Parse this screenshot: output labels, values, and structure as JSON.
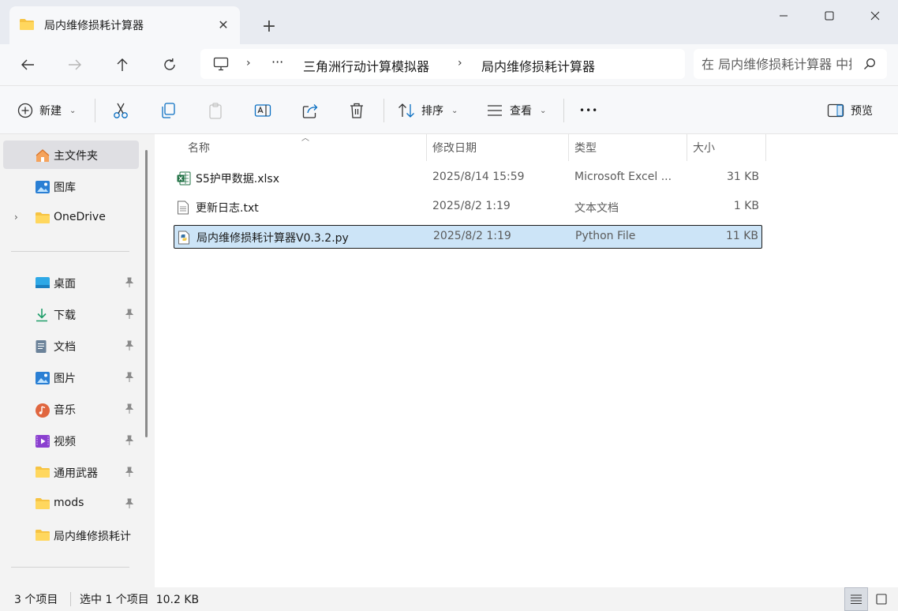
{
  "tab": {
    "title": "局内维修损耗计算器",
    "close": "✕",
    "new_tab": "+"
  },
  "window": {
    "minimize": "—",
    "close": "✕"
  },
  "address": {
    "ellipsis": "···",
    "separator": "›",
    "crumbs": [
      "三角洲行动计算模拟器",
      "局内维修损耗计算器"
    ],
    "search_placeholder": "在 局内维修损耗计算器 中搜索"
  },
  "toolbar": {
    "new_label": "新建",
    "sort_label": "排序",
    "view_label": "查看",
    "more_label": "•••",
    "preview_label": "预览"
  },
  "sidebar": {
    "top_items": [
      {
        "label": "主文件夹",
        "icon": "home-icon"
      },
      {
        "label": "图库",
        "icon": "gallery-icon"
      },
      {
        "label": "OneDrive",
        "icon": "folder-icon"
      }
    ],
    "quick_access": [
      {
        "label": "桌面",
        "icon": "desktop-icon"
      },
      {
        "label": "下载",
        "icon": "download-icon"
      },
      {
        "label": "文档",
        "icon": "document-icon"
      },
      {
        "label": "图片",
        "icon": "pictures-icon"
      },
      {
        "label": "音乐",
        "icon": "music-icon"
      },
      {
        "label": "视频",
        "icon": "video-icon"
      },
      {
        "label": "通用武器",
        "icon": "folder-icon"
      },
      {
        "label": "mods",
        "icon": "folder-icon"
      },
      {
        "label": "局内维修损耗计",
        "icon": "folder-icon"
      }
    ]
  },
  "columns": {
    "name": "名称",
    "date": "修改日期",
    "type": "类型",
    "size": "大小"
  },
  "files": [
    {
      "name": "S5护甲数据.xlsx",
      "date": "2025/8/14 15:59",
      "type": "Microsoft Excel ...",
      "size": "31 KB",
      "icon": "excel-icon"
    },
    {
      "name": "更新日志.txt",
      "date": "2025/8/2 1:19",
      "type": "文本文档",
      "size": "1 KB",
      "icon": "text-file-icon"
    },
    {
      "name": "局内维修损耗计算器V0.3.2.py",
      "date": "2025/8/2 1:19",
      "type": "Python File",
      "size": "11 KB",
      "icon": "python-icon"
    }
  ],
  "selected_file_index": 2,
  "status": {
    "count": "3 个项目",
    "selection": "选中 1 个项目  10.2 KB"
  },
  "colors": {
    "selection_bg": "#cce4f7",
    "accent": "#0067c0"
  }
}
